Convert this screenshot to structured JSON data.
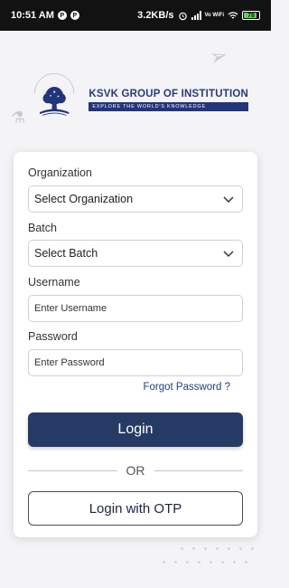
{
  "status_bar": {
    "time": "10:51 AM",
    "speed": "3.2KB/s",
    "network": "Vo WiFi",
    "battery": "78"
  },
  "brand": {
    "name": "KSVK GROUP OF INSTITUTION",
    "tagline": "EXPLORE THE WORLD'S KNOWLEDGE",
    "emblem_top": "IMAGINE · DISCOVER · CONNECT",
    "emblem_left": "SINCE",
    "emblem_right": "1990"
  },
  "form": {
    "organization_label": "Organization",
    "organization_value": "Select Organization",
    "batch_label": "Batch",
    "batch_value": "Select Batch",
    "username_label": "Username",
    "username_placeholder": "Enter Username",
    "password_label": "Password",
    "password_placeholder": "Enter Password",
    "forgot_label": "Forgot Password ?",
    "login_label": "Login",
    "or_label": "OR",
    "otp_label": "Login with OTP"
  },
  "colors": {
    "primary": "#263a66",
    "brand": "#23357a",
    "link": "#1f3f7a"
  },
  "icons": [
    "wifi-icon",
    "alarm-icon",
    "signal-icon",
    "battery-icon",
    "chevron-down-icon",
    "tree-emblem-icon"
  ]
}
